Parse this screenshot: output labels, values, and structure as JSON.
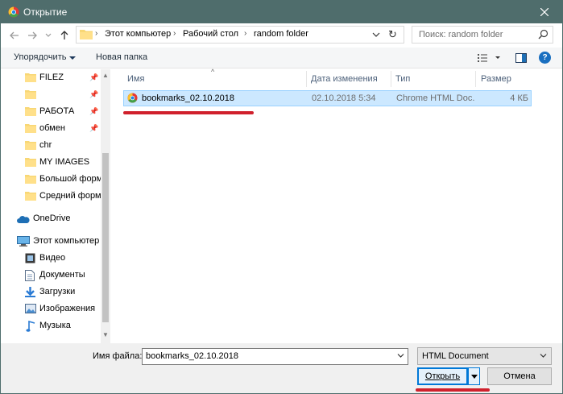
{
  "window": {
    "title": "Открытие"
  },
  "address": {
    "crumbs": [
      "Этот компьютер",
      "Рабочий стол",
      "random folder"
    ]
  },
  "search": {
    "placeholder": "Поиск: random folder"
  },
  "toolbar": {
    "organize_label": "Упорядочить",
    "new_folder_label": "Новая папка"
  },
  "sidebar": {
    "items": [
      {
        "label": "FILEZ",
        "icon": "folder-icon",
        "pinned": true
      },
      {
        "label": "",
        "icon": "folder-icon",
        "pinned": true
      },
      {
        "label": "РАБОТА",
        "icon": "folder-icon",
        "pinned": true
      },
      {
        "label": "обмен",
        "icon": "folder-icon",
        "pinned": true
      },
      {
        "label": "chr",
        "icon": "folder-icon",
        "pinned": false
      },
      {
        "label": "MY IMAGES",
        "icon": "folder-icon",
        "pinned": false
      },
      {
        "label": "Большой форм",
        "icon": "folder-icon",
        "pinned": false
      },
      {
        "label": "Средний форма",
        "icon": "folder-icon",
        "pinned": false
      },
      {
        "label": "OneDrive",
        "icon": "cloud-icon",
        "pinned": false
      },
      {
        "label": "Этот компьютер",
        "icon": "computer-icon",
        "pinned": false
      },
      {
        "label": "Видео",
        "icon": "video-icon",
        "pinned": false
      },
      {
        "label": "Документы",
        "icon": "documents-icon",
        "pinned": false
      },
      {
        "label": "Загрузки",
        "icon": "download-icon",
        "pinned": false
      },
      {
        "label": "Изображения",
        "icon": "pictures-icon",
        "pinned": false
      },
      {
        "label": "Музыка",
        "icon": "music-icon",
        "pinned": false
      }
    ]
  },
  "columns": {
    "name": "Имя",
    "modified": "Дата изменения",
    "type": "Тип",
    "size": "Размер"
  },
  "files": [
    {
      "name": "bookmarks_02.10.2018",
      "modified": "02.10.2018 5:34",
      "type": "Chrome HTML Doc...",
      "size": "4 КБ",
      "selected": true
    }
  ],
  "bottom": {
    "filename_label": "Имя файла:",
    "filename_value": "bookmarks_02.10.2018",
    "filetype_value": "HTML Document",
    "open_label": "Открыть",
    "cancel_label": "Отмена"
  },
  "colors": {
    "titlebar": "#4f6d6c",
    "selection": "#cce8ff",
    "highlight_underline": "#d0202c",
    "accent": "#0078d7"
  }
}
